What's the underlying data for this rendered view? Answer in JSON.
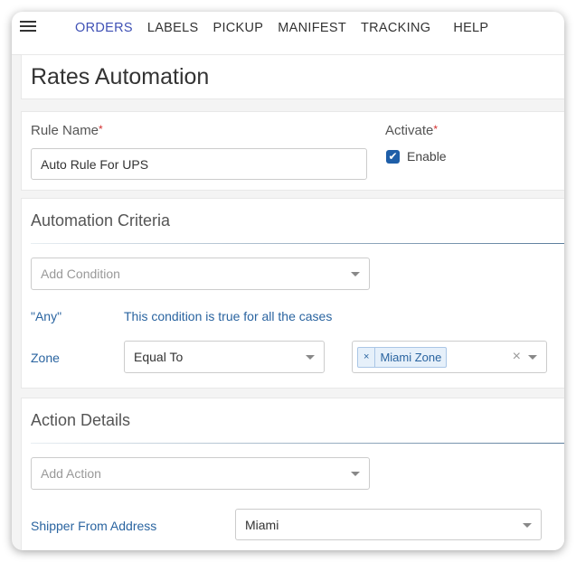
{
  "nav": {
    "menu_icon": "hamburger-menu-icon",
    "items": [
      {
        "label": "ORDERS",
        "active": true
      },
      {
        "label": "LABELS",
        "active": false
      },
      {
        "label": "PICKUP",
        "active": false
      },
      {
        "label": "MANIFEST",
        "active": false
      },
      {
        "label": "TRACKING",
        "active": false
      },
      {
        "label": "HELP",
        "active": false
      }
    ],
    "active_color": "#3f51b5"
  },
  "page": {
    "title": "Rates Automation"
  },
  "rule": {
    "name_label": "Rule Name",
    "required_mark": "*",
    "name_value": "Auto Rule For UPS",
    "activate_label": "Activate",
    "enable_label": "Enable",
    "enable_checked": true,
    "check_glyph": "✔"
  },
  "criteria": {
    "title": "Automation Criteria",
    "add_condition_placeholder": "Add Condition",
    "any_label": "\"Any\"",
    "any_description": "This condition is true for all the cases",
    "zone_label": "Zone",
    "operator_value": "Equal To",
    "zone_tags": [
      "Miami Zone"
    ],
    "tag_remove_glyph": "×",
    "clear_glyph": "×"
  },
  "action": {
    "title": "Action Details",
    "add_action_placeholder": "Add Action",
    "shipper_label": "Shipper From Address",
    "shipper_value": "Miami"
  },
  "colors": {
    "link_blue": "#2a64a0",
    "checkbox": "#1e5ea8",
    "required": "#d32f2f"
  }
}
